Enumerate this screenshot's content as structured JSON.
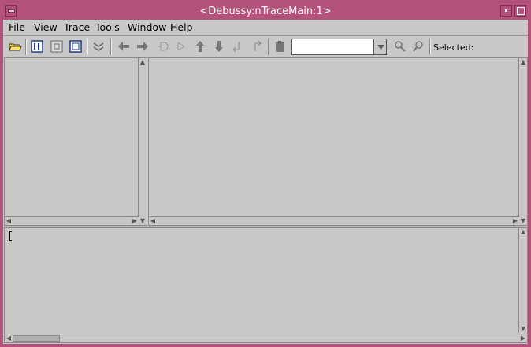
{
  "window": {
    "title": "<Debussy:nTraceMain:1>"
  },
  "menu": [
    {
      "label": "File"
    },
    {
      "label": "View"
    },
    {
      "label": "Trace"
    },
    {
      "label": "Tools"
    },
    {
      "label": "Window"
    },
    {
      "label": "Help"
    }
  ],
  "toolbar": {
    "search_value": "",
    "selected_label": "Selected:",
    "icons": [
      "open-folder-icon",
      "hierarchy-browser-icon",
      "schematic-icon",
      "source-view-icon",
      "trace-icon",
      "back-arrow-icon",
      "forward-arrow-icon",
      "driver-icon",
      "load-icon",
      "up-arrow-icon",
      "down-arrow-icon",
      "step-in-icon",
      "step-out-icon",
      "clipboard-icon",
      "find-previous-icon",
      "find-next-icon"
    ]
  },
  "colors": {
    "titlebar": "#b3527a",
    "panel": "#c8c8c8",
    "title_text": "#ffffff"
  }
}
